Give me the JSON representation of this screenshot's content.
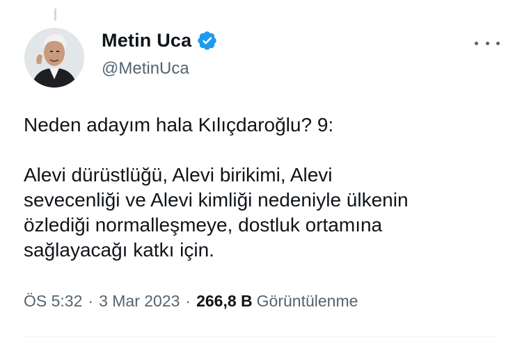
{
  "author": {
    "display_name": "Metin Uca",
    "handle": "@MetinUca",
    "verified": true,
    "verified_color": "#1d9bf0",
    "avatar_icon": "profile-photo"
  },
  "more_icon": "ellipsis-icon",
  "tweet": {
    "text": "Neden adayım hala Kılıçdaroğlu? 9:\n\nAlevi dürüstlüğü, Alevi birikimi, Alevi\nsevecenliği ve Alevi kimliği nedeniyle ülkenin\nözlediği normalleşmeye, dostluk ortamına\nsağlayacağı katkı için."
  },
  "meta": {
    "time": "ÖS 5:32",
    "separator": "·",
    "date": "3 Mar 2023",
    "views_count": "266,8 B",
    "views_label": "Görüntülenme"
  }
}
